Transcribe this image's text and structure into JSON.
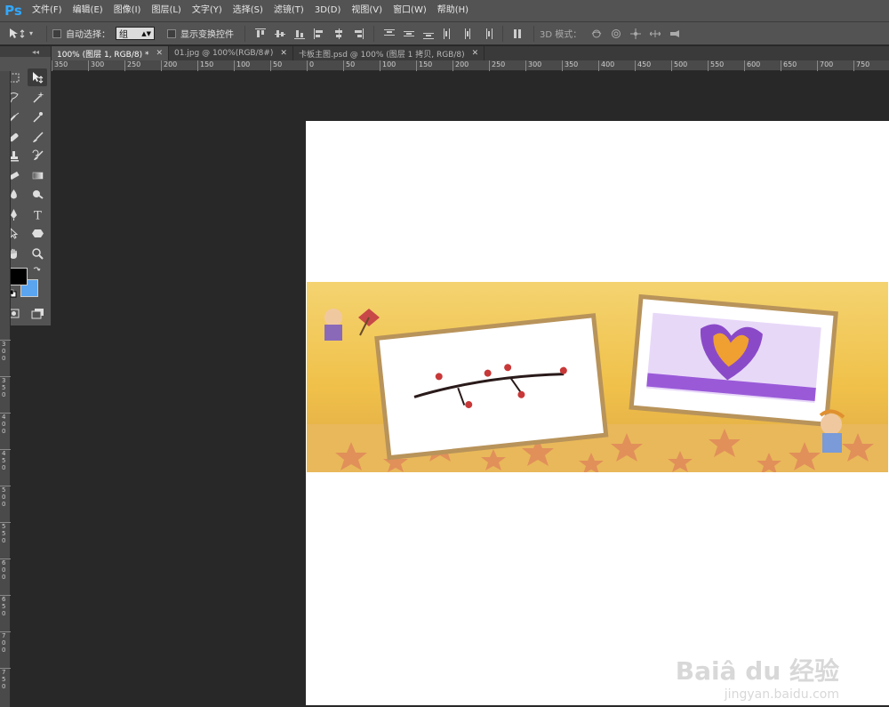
{
  "app": {
    "logo": "Ps"
  },
  "menu": [
    "文件(F)",
    "编辑(E)",
    "图像(I)",
    "图层(L)",
    "文字(Y)",
    "选择(S)",
    "滤镜(T)",
    "3D(D)",
    "视图(V)",
    "窗口(W)",
    "帮助(H)"
  ],
  "options": {
    "auto_select_label": "自动选择：",
    "auto_select_value": "组",
    "show_transform_label": "显示变换控件",
    "mode_3d_label": "3D 模式："
  },
  "tabs": [
    {
      "label": "100% (图层 1, RGB/8) *",
      "active": true
    },
    {
      "label": "01.jpg @ 100%(RGB/8#)",
      "active": false
    },
    {
      "label": "卡板主图.psd @ 100% (图层 1 拷贝, RGB/8)",
      "active": false
    }
  ],
  "hruler": [
    "350",
    "300",
    "250",
    "200",
    "150",
    "100",
    "50",
    "0",
    "50",
    "100",
    "150",
    "200",
    "250",
    "300",
    "350",
    "400",
    "450",
    "500",
    "550",
    "600",
    "650",
    "700",
    "750"
  ],
  "vruler": [
    "3\n0\n0",
    "3\n5\n0",
    "4\n0\n0",
    "4\n5\n0",
    "5\n0\n0",
    "5\n5\n0",
    "6\n0\n0",
    "6\n5\n0",
    "7\n0\n0",
    "7\n5\n0"
  ],
  "toolbar_header": "◂◂",
  "watermark": {
    "main": "Baiâ du 经验",
    "sub": "jingyan.baidu.com"
  },
  "colors": {
    "foreground": "#000000",
    "background": "#5aa4f0",
    "accent": "#31a8ff"
  }
}
